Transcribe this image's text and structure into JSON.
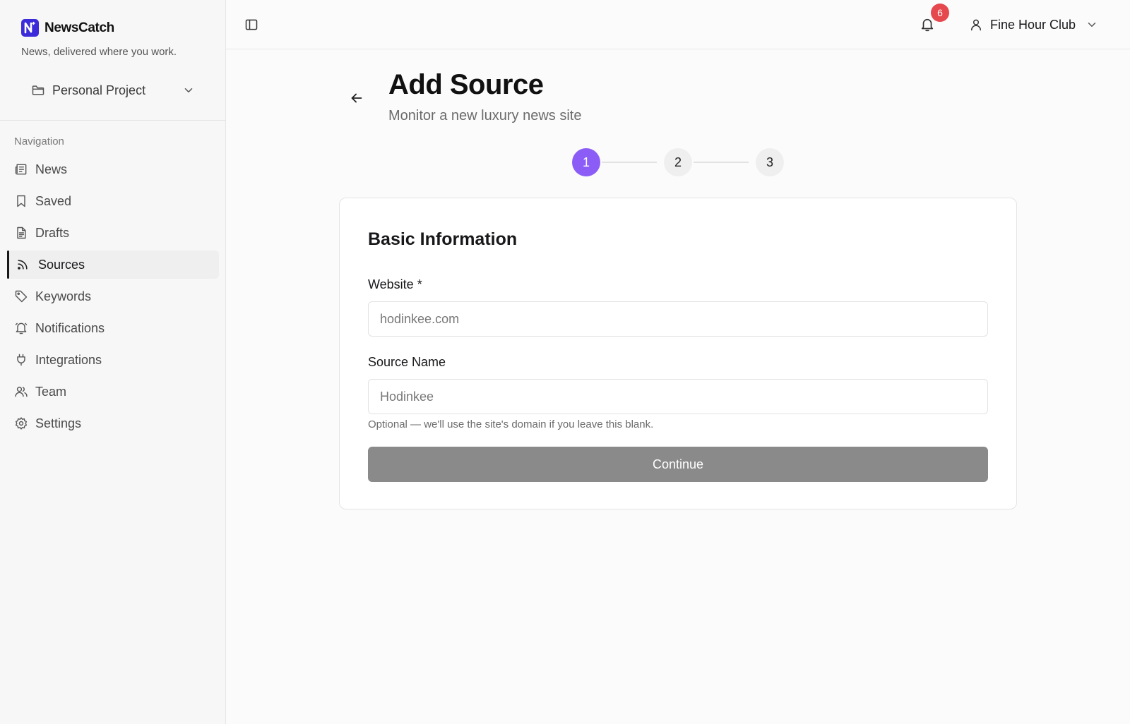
{
  "brand": {
    "name": "NewsCatch",
    "tagline": "News, delivered where you work.",
    "accent": "#3b2bd8"
  },
  "project": {
    "label": "Personal Project"
  },
  "nav": {
    "heading": "Navigation",
    "items": [
      {
        "label": "News",
        "icon": "newspaper-icon"
      },
      {
        "label": "Saved",
        "icon": "bookmark-icon"
      },
      {
        "label": "Drafts",
        "icon": "file-text-icon"
      },
      {
        "label": "Sources",
        "icon": "rss-icon",
        "active": true
      },
      {
        "label": "Keywords",
        "icon": "tag-icon"
      },
      {
        "label": "Notifications",
        "icon": "bell-icon"
      },
      {
        "label": "Integrations",
        "icon": "plug-icon"
      },
      {
        "label": "Team",
        "icon": "users-icon"
      },
      {
        "label": "Settings",
        "icon": "gear-icon"
      }
    ]
  },
  "topbar": {
    "notifications_count": "6",
    "user_name": "Fine Hour Club",
    "badge_color": "#e5484d"
  },
  "page": {
    "title": "Add Source",
    "subtitle": "Monitor a new luxury news site"
  },
  "stepper": {
    "steps": [
      "1",
      "2",
      "3"
    ],
    "current": 1,
    "active_color": "#8b5cf6"
  },
  "form": {
    "section_title": "Basic Information",
    "website_label": "Website *",
    "website_placeholder": "hodinkee.com",
    "website_value": "",
    "name_label": "Source Name",
    "name_placeholder": "Hodinkee",
    "name_value": "",
    "name_help": "Optional — we'll use the site's domain if you leave this blank.",
    "continue_label": "Continue"
  }
}
